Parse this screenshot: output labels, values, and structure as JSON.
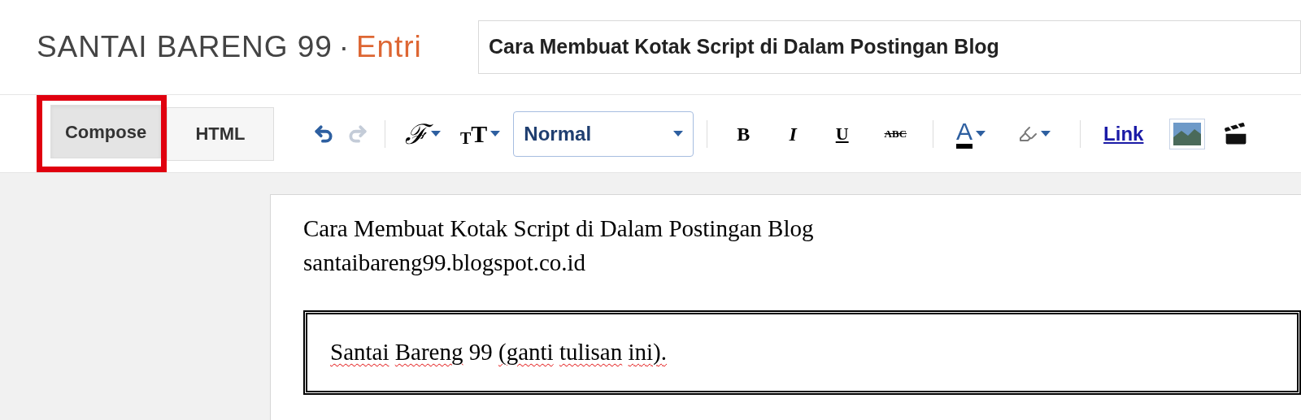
{
  "header": {
    "blog_name": "SANTAI BARENG 99",
    "separator": "·",
    "section": "Entri",
    "post_title": "Cara Membuat Kotak Script di Dalam Postingan Blog"
  },
  "mode_tabs": [
    {
      "label": "Compose",
      "selected": true,
      "highlighted": true
    },
    {
      "label": "HTML",
      "selected": false,
      "highlighted": false
    }
  ],
  "toolbar": [
    {
      "kind": "undo",
      "disabled": false
    },
    {
      "kind": "redo",
      "disabled": true
    },
    {
      "kind": "separator"
    },
    {
      "kind": "font-family",
      "label": "ℱ"
    },
    {
      "kind": "font-size",
      "label": "TT"
    },
    {
      "kind": "format-select",
      "value": "Normal"
    },
    {
      "kind": "separator"
    },
    {
      "kind": "bold",
      "label": "B"
    },
    {
      "kind": "italic",
      "label": "I"
    },
    {
      "kind": "underline",
      "label": "U"
    },
    {
      "kind": "strike",
      "label": "ABC"
    },
    {
      "kind": "separator"
    },
    {
      "kind": "text-color",
      "label": "A"
    },
    {
      "kind": "highlight"
    },
    {
      "kind": "separator"
    },
    {
      "kind": "link",
      "label": "Link"
    },
    {
      "kind": "image"
    },
    {
      "kind": "video"
    }
  ],
  "editor": {
    "lines": [
      "Cara Membuat Kotak Script di Dalam Postingan Blog",
      "santaibareng99.blogspot.co.id"
    ],
    "script_box": [
      {
        "word": "Santai",
        "misspelled": true
      },
      {
        "word": "Bareng",
        "misspelled": true
      },
      {
        "word": "99",
        "misspelled": false
      },
      {
        "word": "(ganti",
        "misspelled": true
      },
      {
        "word": "tulisan",
        "misspelled": true
      },
      {
        "word": "ini).",
        "misspelled": true
      }
    ]
  }
}
